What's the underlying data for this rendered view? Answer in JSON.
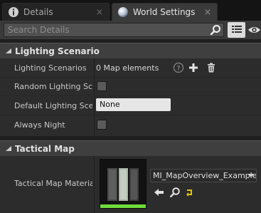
{
  "tabs": [
    {
      "label": "Details",
      "icon": "info-icon",
      "active": false
    },
    {
      "label": "World Settings",
      "icon": "globe-icon",
      "active": true
    }
  ],
  "search": {
    "placeholder": "Search Details"
  },
  "categories": {
    "lighting": {
      "title": "Lighting Scenario",
      "rows": {
        "lighting_scenarios": {
          "label": "Lighting Scenarios",
          "value": "0 Map elements"
        },
        "random_lighting": {
          "label": "Random Lighting Scenario"
        },
        "default_lighting": {
          "label": "Default Lighting Scenario",
          "value": "None"
        },
        "always_night": {
          "label": "Always Night"
        }
      }
    },
    "tactical": {
      "title": "Tactical Map",
      "rows": {
        "material": {
          "label": "Tactical Map Material",
          "asset": "MI_MapOverview_Example"
        }
      }
    }
  },
  "colors": {
    "accent_green": "#6fdc3c",
    "browse_yellow": "#e8c400"
  }
}
